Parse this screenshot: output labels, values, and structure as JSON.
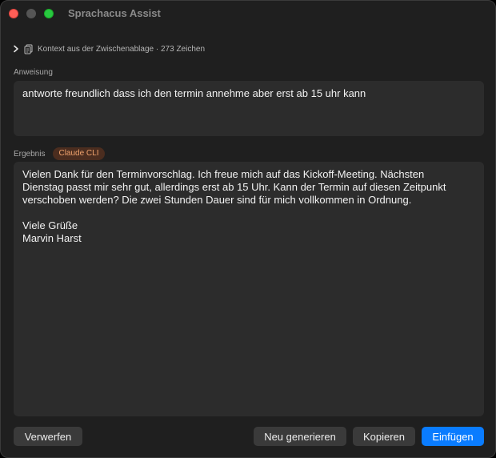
{
  "window": {
    "title": "Sprachacus Assist"
  },
  "context": {
    "label": "Kontext aus der Zwischenablage · 273 Zeichen",
    "chevron_icon": "chevron-right-icon",
    "clipboard_icon": "clipboard-icon"
  },
  "instruction": {
    "label": "Anweisung",
    "value": "antworte freundlich dass ich den termin annehme aber erst ab 15 uhr kann"
  },
  "result": {
    "label": "Ergebnis",
    "badge": "Claude CLI",
    "value": "Vielen Dank für den Terminvorschlag. Ich freue mich auf das Kickoff-Meeting. Nächsten\nDienstag passt mir sehr gut, allerdings erst ab 15 Uhr. Kann der Termin auf diesen Zeitpunkt\nverschoben werden? Die zwei Stunden Dauer sind für mich vollkommen in Ordnung.\n\nViele Grüße\nMarvin Harst"
  },
  "buttons": {
    "discard": "Verwerfen",
    "regenerate": "Neu generieren",
    "copy": "Kopieren",
    "insert": "Einfügen"
  },
  "colors": {
    "close": "#fe5f57",
    "maximize": "#28c840",
    "accent": "#0a7cff",
    "badge_text": "#f0a36d"
  }
}
